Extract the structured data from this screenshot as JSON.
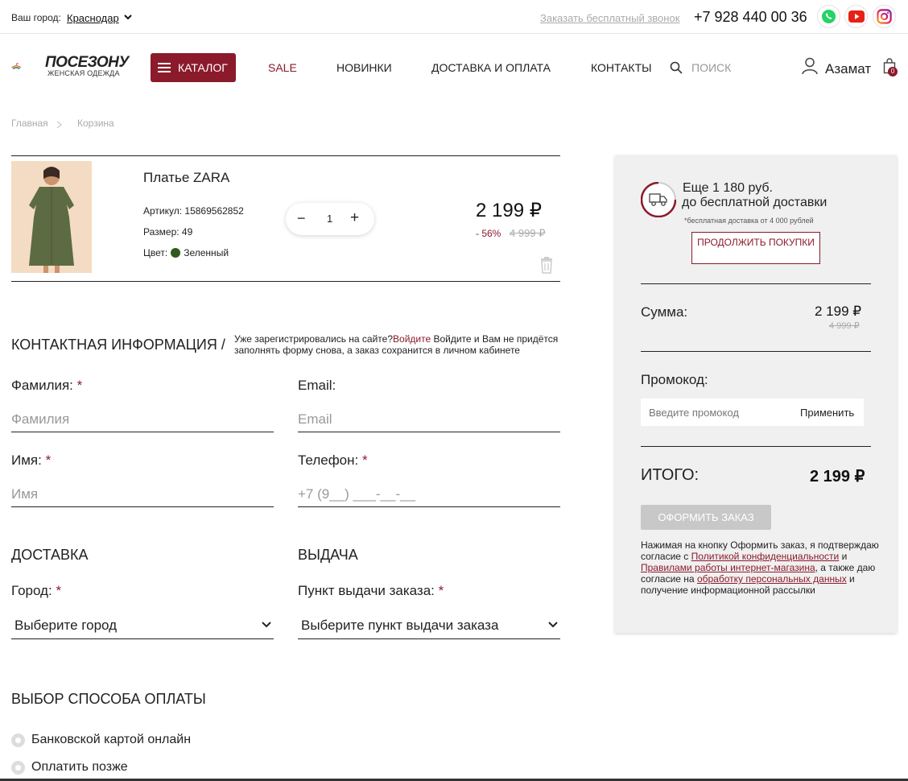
{
  "topbar": {
    "city_label": "Ваш город:",
    "city_value": "Краснодар",
    "callback": "Заказать бесплатный звонок",
    "phone": "+7 928 440 00 36"
  },
  "header": {
    "logo_text": "ПОСЕЗОНУ",
    "logo_sub": "ЖЕНСКАЯ ОДЕЖДА",
    "catalog": "КАТАЛОГ",
    "nav": [
      "SALE",
      "НОВИНКИ",
      "ДОСТАВКА И ОПЛАТА",
      "КОНТАКТЫ"
    ],
    "search_placeholder": "ПОИСК",
    "user_name": "Азамат",
    "cart_count": "0"
  },
  "breadcrumb": [
    "Главная",
    "Корзина"
  ],
  "cart_item": {
    "title": "Платье ZARA",
    "article": "Артикул: 15869562852",
    "size": "Размер: 49",
    "color_label": "Цвет:",
    "color_value": "Зеленный",
    "qty": "1",
    "price": "2 199 ₽",
    "discount": "- 56%",
    "old_price": "4 999 ₽"
  },
  "contact": {
    "title": "КОНТАКТНАЯ ИНФОРМАЦИЯ /",
    "note_before": "Уже зарегистрировались на сайте?",
    "note_login": "Войдите",
    "note_after": " Войдите и Вам не придётся заполнять форму снова, а заказ сохранится в личном кабинете",
    "surname_label": "Фамилия:",
    "surname_placeholder": "Фамилия",
    "email_label": "Email:",
    "email_placeholder": "Email",
    "name_label": "Имя:",
    "name_placeholder": "Имя",
    "phone_label": "Телефон:",
    "phone_placeholder": "+7 (9__) ___-__-__",
    "required_mark": "*"
  },
  "delivery": {
    "title": "ДОСТАВКА",
    "city_label": "Город:",
    "city_select": "Выберите город",
    "pickup_title": "ВЫДАЧА",
    "pickup_label": "Пункт выдачи заказа:",
    "pickup_select": "Выберите пункт выдачи заказа"
  },
  "payment": {
    "title": "ВЫБОР СПОСОБА ОПЛАТЫ",
    "options": [
      "Банковской картой онлайн",
      "Оплатить позже"
    ]
  },
  "summary": {
    "free_line1": "Еще 1 180 руб.",
    "free_line2": "до бесплатной доставки",
    "free_note": "*бесплатная доставка от 4 000 рублей",
    "continue_btn": "ПРОДОЛЖИТЬ ПОКУПКИ",
    "sum_label": "Сумма:",
    "sum_value": "2 199 ₽",
    "sum_old": "4 999 ₽",
    "promo_label": "Промокод:",
    "promo_placeholder": "Введите промокод",
    "promo_apply": "Применить",
    "total_label": "ИТОГО:",
    "total_value": "2 199 ₽",
    "order_btn": "ОФОРМИТЬ ЗАКАЗ",
    "consent_1": "Нажимая на кнопку Оформить заказ, я подтверждаю согласие с ",
    "consent_link1": "Политикой конфиденциальности",
    "consent_2": " и ",
    "consent_link2": "Правилами работы интернет-магазина",
    "consent_3": ", а также даю согласие на ",
    "consent_link3": "обработку персональных данных",
    "consent_4": " и получение информационной рассылки"
  },
  "colors": {
    "brand": "#8b1a2b",
    "product_color": "#2f5a1e"
  }
}
